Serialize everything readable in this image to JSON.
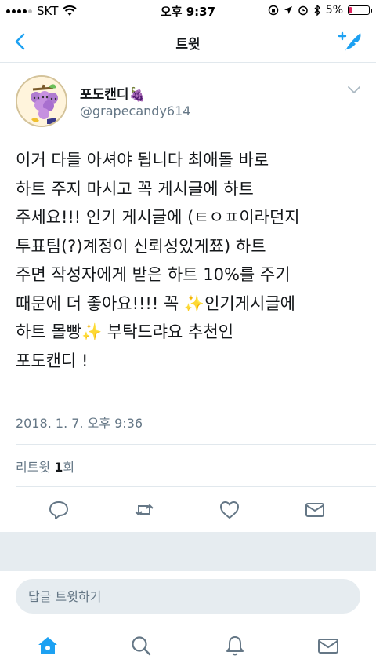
{
  "status_bar": {
    "carrier": "SKT",
    "time": "오후 9:37",
    "battery_percent": "5%",
    "battery_level": 0.05,
    "battery_color": "#e0245e"
  },
  "nav": {
    "title": "트윗",
    "back_icon": "chevron-left-icon",
    "compose_icon": "compose-tweet-icon"
  },
  "tweet": {
    "author_name": "포도캔디🍇",
    "author_handle": "@grapecandy614",
    "text": "이거 다들 아셔야 됩니다 최애돌 바로\n하트 주지 마시고 꼭 게시글에 하트\n주세요!!! 인기 게시글에 (ㅌㅇㅍ이라던지\n투표팀(?)계정이 신뢰성있게쬬) 하트\n주면 작성자에게 받은 하트 10%를 주기\n때문에 더 좋아요!!!! 꼭 ✨인기게시글에\n하트 몰빵✨ 부탁드랴요 추천인\n포도캔디 !",
    "timestamp": "2018. 1. 7. 오후 9:36",
    "retweet_label": "리트윗",
    "retweet_count": "1",
    "retweet_suffix": "회"
  },
  "actions": [
    "reply-icon",
    "retweet-icon",
    "like-icon",
    "direct-message-icon"
  ],
  "reply": {
    "placeholder": "답글 트윗하기"
  },
  "tabs": [
    "home-icon",
    "search-icon",
    "notifications-icon",
    "messages-icon"
  ],
  "colors": {
    "accent": "#1da1f2",
    "secondary_text": "#657786",
    "divider": "#e1e8ed",
    "band": "#e6ecf0"
  }
}
